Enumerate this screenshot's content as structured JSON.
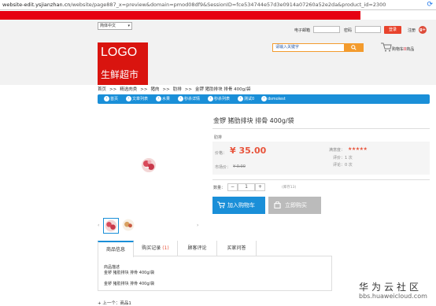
{
  "browser": {
    "url_host": "website-edit.ysjianzhan.cn",
    "url_path": "/website/page887_x=preview&domain=pmod08df9&SessionID=fce534744e57d3e0914a07260a52e2da&product_id=2300"
  },
  "topbar": {
    "language": "简体中文",
    "email_label": "电子邮箱",
    "password_label": "密码",
    "login_button": "登录",
    "register_link": "注册",
    "social_icon": "g+"
  },
  "header": {
    "logo_line1": "LOGO",
    "logo_line2": "生鲜超市",
    "search_placeholder": "请输入关键字",
    "cart_label": "购物车",
    "cart_count": "0",
    "cart_suffix": "商品"
  },
  "breadcrumb": [
    "首页",
    ">>",
    "精选肉类",
    ">>",
    "猪肉",
    ">>",
    "肋排",
    ">>",
    "金锣 猪肋排块 排骨 400g/袋"
  ],
  "nav": [
    "首页",
    "文章列表",
    "水果",
    "秒杀详情",
    "秒杀列表",
    "测试0",
    "dsmolest"
  ],
  "product": {
    "title": "金锣 猪肋排块 排骨 400g/袋",
    "subtitle": "肋排",
    "price_label": "价格：",
    "price": "¥ 35.00",
    "market_label": "市场价：",
    "market_price": "¥ 0.00",
    "satisfaction_label": "满意度：",
    "stars": "★★★★★",
    "rating_count": "1",
    "review_count": "0",
    "rating_label": "评价：",
    "review_label": "评论：",
    "unit": "次",
    "qty_label": "数量：",
    "qty_minus": "−",
    "qty_value": "1",
    "qty_plus": "+",
    "stock": "(库存13)",
    "add_to_cart": "加入购物车",
    "buy_now": "立即购买"
  },
  "tabs": [
    {
      "label": "商品信息",
      "count": ""
    },
    {
      "label": "购买记录",
      "count": "(1)"
    },
    {
      "label": "顾客评论",
      "count": ""
    },
    {
      "label": "买家问答",
      "count": ""
    }
  ],
  "description": {
    "heading": "商品描述",
    "line1": "金锣 猪肋排块 排骨 400g/袋",
    "line2": "金锣 猪肋排块 排骨 400g/袋"
  },
  "prev_link": "上一个：商品1",
  "watermark": {
    "line1": "华为云社区",
    "line2": "bbs.huaweicloud.com"
  },
  "colors": {
    "brand_red": "#d9140f",
    "nav_blue": "#1a8fd8",
    "price_orange": "#e8543c",
    "search_orange": "#f39b2d"
  }
}
